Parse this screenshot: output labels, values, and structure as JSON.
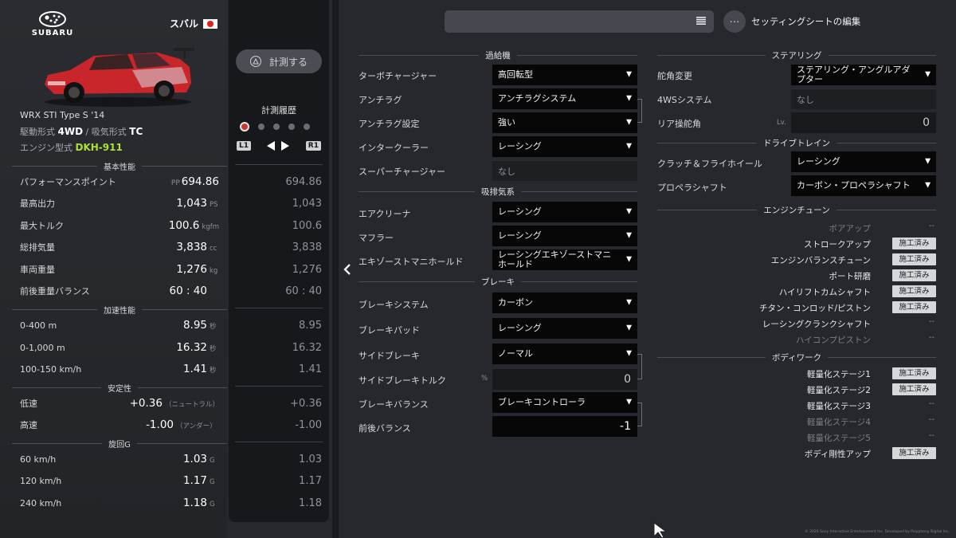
{
  "car": {
    "brand_wordmark": "SUBARU",
    "maker": "スバル",
    "name": "WRX STI Type S '14",
    "drivetrain_label": "駆動形式",
    "drivetrain": "4WD",
    "separator": "/",
    "aspiration_label": "吸気形式",
    "aspiration": "TC",
    "engine_label": "エンジン型式",
    "engine": "DKH-911"
  },
  "sections": {
    "basic": "基本性能",
    "accel": "加速性能",
    "stability": "安定性",
    "cornering": "旋回G"
  },
  "stats": {
    "pp": {
      "label": "パフォーマンスポイント",
      "prefix": "PP",
      "value": "694.86",
      "unit": ""
    },
    "power": {
      "label": "最高出力",
      "value": "1,043",
      "unit": "PS"
    },
    "torque": {
      "label": "最大トルク",
      "value": "100.6",
      "unit": "kgfm"
    },
    "displacement": {
      "label": "総排気量",
      "value": "3,838",
      "unit": "cc"
    },
    "weight": {
      "label": "車両重量",
      "value": "1,276",
      "unit": "kg"
    },
    "balance": {
      "label": "前後重量バランス",
      "value": "60 : 40",
      "unit": ""
    },
    "a400": {
      "label": "0-400 m",
      "value": "8.95",
      "unit": "秒"
    },
    "a1000": {
      "label": "0-1,000 m",
      "value": "16.32",
      "unit": "秒"
    },
    "a100150": {
      "label": "100-150 km/h",
      "value": "1.41",
      "unit": "秒"
    },
    "low": {
      "label": "低速",
      "value": "+0.36",
      "unit": "（ニュートラル）"
    },
    "high": {
      "label": "高速",
      "value": "-1.00",
      "unit": "（アンダー）"
    },
    "g60": {
      "label": "60 km/h",
      "value": "1.03",
      "unit": "G"
    },
    "g120": {
      "label": "120 km/h",
      "value": "1.17",
      "unit": "G"
    },
    "g240": {
      "label": "240 km/h",
      "value": "1.18",
      "unit": "G"
    }
  },
  "compare": {
    "measure_button": "計測する",
    "history_title": "計測履歴",
    "l1": "L1",
    "r1": "R1",
    "values": [
      "694.86",
      "1,043",
      "100.6",
      "3,838",
      "1,276",
      "60 : 40",
      "8.95",
      "16.32",
      "1.41",
      "+0.36",
      "-1.00",
      "1.03",
      "1.17",
      "1.18"
    ]
  },
  "topbar": {
    "edit_sheet": "セッティングシートの編集",
    "more": "···"
  },
  "groups": {
    "supercharging": "過給機",
    "intake_exhaust": "吸排気系",
    "brakes": "ブレーキ",
    "steering": "ステアリング",
    "drivetrain": "ドライブトレイン",
    "engine_tune": "エンジンチューン",
    "bodywork": "ボディワーク"
  },
  "settings": {
    "turbo": {
      "label": "ターボチャージャー",
      "value": "高回転型"
    },
    "antilag": {
      "label": "アンチラグ",
      "value": "アンチラグシステム"
    },
    "antilag_setting": {
      "label": "アンチラグ設定",
      "value": "強い"
    },
    "intercooler": {
      "label": "インタークーラー",
      "value": "レーシング"
    },
    "supercharger": {
      "label": "スーパーチャージャー",
      "value": "なし"
    },
    "air_cleaner": {
      "label": "エアクリーナ",
      "value": "レーシング"
    },
    "muffler": {
      "label": "マフラー",
      "value": "レーシング"
    },
    "exhaust_manifold": {
      "label": "エキゾーストマニホールド",
      "value": "レーシングエキゾーストマニホールド"
    },
    "brake_system": {
      "label": "ブレーキシステム",
      "value": "カーボン"
    },
    "brake_pad": {
      "label": "ブレーキパッド",
      "value": "レーシング"
    },
    "handbrake": {
      "label": "サイドブレーキ",
      "value": "ノーマル"
    },
    "handbrake_torque": {
      "label": "サイドブレーキトルク",
      "unit": "%",
      "value": "0"
    },
    "brake_balance": {
      "label": "ブレーキバランス",
      "value": "ブレーキコントローラ"
    },
    "fr_balance": {
      "label": "前後バランス",
      "value": "-1"
    },
    "steering_angle": {
      "label": "舵角変更",
      "value": "ステアリング・アングルアダプター"
    },
    "four_ws": {
      "label": "4WSシステム",
      "value": "なし"
    },
    "rear_steer": {
      "label": "リア操舵角",
      "unit": "Lv.",
      "value": "0"
    },
    "clutch": {
      "label": "クラッチ＆フライホイール",
      "value": "レーシング"
    },
    "prop_shaft": {
      "label": "プロペラシャフト",
      "value": "カーボン・プロペラシャフト"
    }
  },
  "engine_tune": [
    {
      "label": "ボアアップ",
      "status": "--"
    },
    {
      "label": "ストロークアップ",
      "status": "施工済み"
    },
    {
      "label": "エンジンバランスチューン",
      "status": "施工済み"
    },
    {
      "label": "ポート研磨",
      "status": "施工済み"
    },
    {
      "label": "ハイリフトカムシャフト",
      "status": "施工済み"
    },
    {
      "label": "チタン・コンロッド/ピストン",
      "status": "施工済み"
    },
    {
      "label": "レーシングクランクシャフト",
      "status": "--"
    },
    {
      "label": "ハイコンプピストン",
      "status": "--"
    }
  ],
  "bodywork": [
    {
      "label": "軽量化ステージ1",
      "status": "施工済み"
    },
    {
      "label": "軽量化ステージ2",
      "status": "施工済み"
    },
    {
      "label": "軽量化ステージ3",
      "status": "--"
    },
    {
      "label": "軽量化ステージ4",
      "status": "--"
    },
    {
      "label": "軽量化ステージ5",
      "status": "--"
    },
    {
      "label": "ボディ剛性アップ",
      "status": "施工済み"
    }
  ],
  "copyright": "© 2020 Sony Interactive Entertainment Inc. Developed by Polyphony Digital Inc.",
  "colors": {
    "engine_code": "#aee036",
    "select_bg": "#070708",
    "status_badge": "#d6d7da",
    "car_red": "#c8262a"
  }
}
